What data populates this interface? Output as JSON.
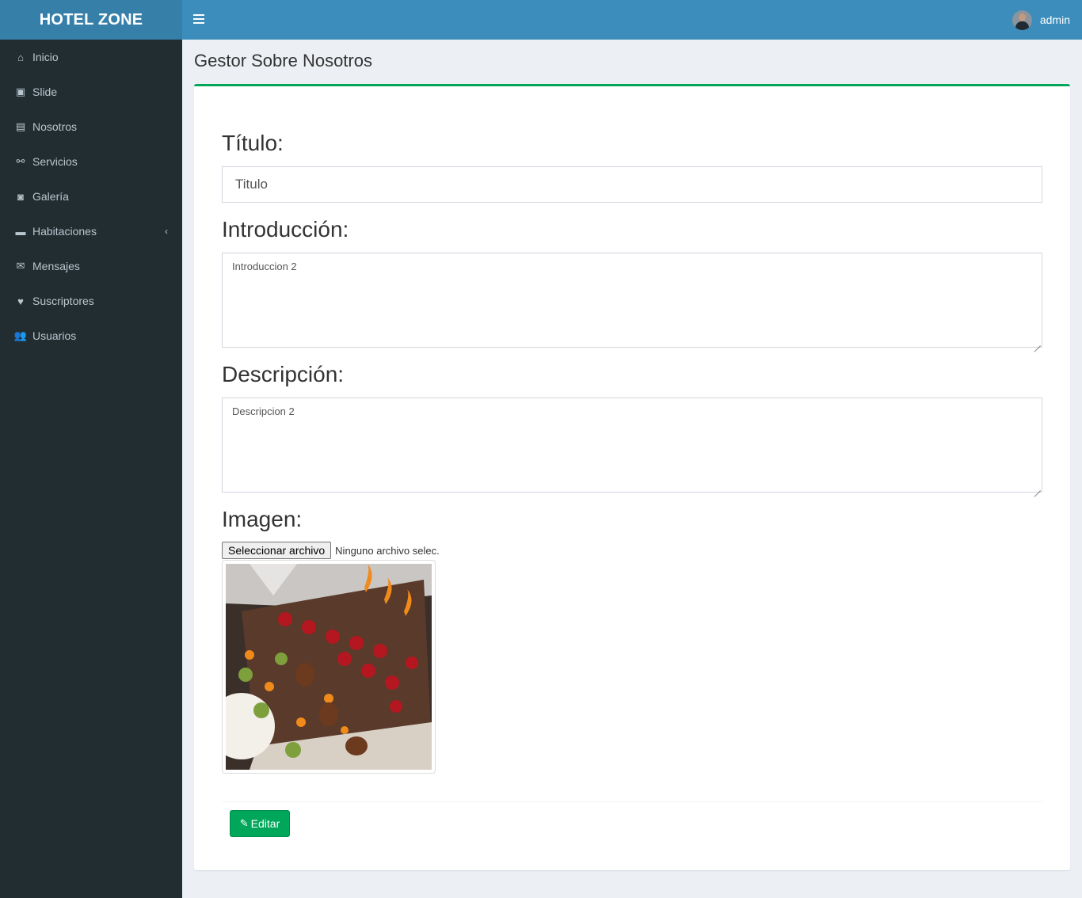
{
  "app": {
    "logo": "HOTEL ZONE"
  },
  "navbar": {
    "username": "admin"
  },
  "sidebar": {
    "items": [
      {
        "label": "Inicio",
        "icon": "home-icon",
        "glyph": "⌂"
      },
      {
        "label": "Slide",
        "icon": "image-icon",
        "glyph": "▣"
      },
      {
        "label": "Nosotros",
        "icon": "id-card-icon",
        "glyph": "▤"
      },
      {
        "label": "Servicios",
        "icon": "handshake-icon",
        "glyph": "⚯"
      },
      {
        "label": "Galería",
        "icon": "camera-icon",
        "glyph": "◙"
      },
      {
        "label": "Habitaciones",
        "icon": "bed-icon",
        "glyph": "▬"
      },
      {
        "label": "Mensajes",
        "icon": "envelope-icon",
        "glyph": "✉"
      },
      {
        "label": "Suscriptores",
        "icon": "heart-icon",
        "glyph": "♥"
      },
      {
        "label": "Usuarios",
        "icon": "users-icon",
        "glyph": "👥"
      }
    ],
    "expand_glyph": "‹"
  },
  "page": {
    "title": "Gestor Sobre Nosotros"
  },
  "form": {
    "titulo_label": "Título:",
    "titulo_value": "Titulo",
    "intro_label": "Introducción:",
    "intro_value": "Introduccion 2",
    "desc_label": "Descripción:",
    "desc_value": "Descripcion 2",
    "imagen_label": "Imagen:",
    "file_button": "Seleccionar archivo",
    "file_status": "Ninguno archivo selec.",
    "submit_label": "Editar",
    "submit_glyph": "✎"
  },
  "colors": {
    "header": "#3c8dbc",
    "logo_bg": "#367fa9",
    "sidebar": "#222d32",
    "sidebar_text": "#b8c7ce",
    "accent_green": "#00a65a",
    "background": "#ecf0f5"
  }
}
